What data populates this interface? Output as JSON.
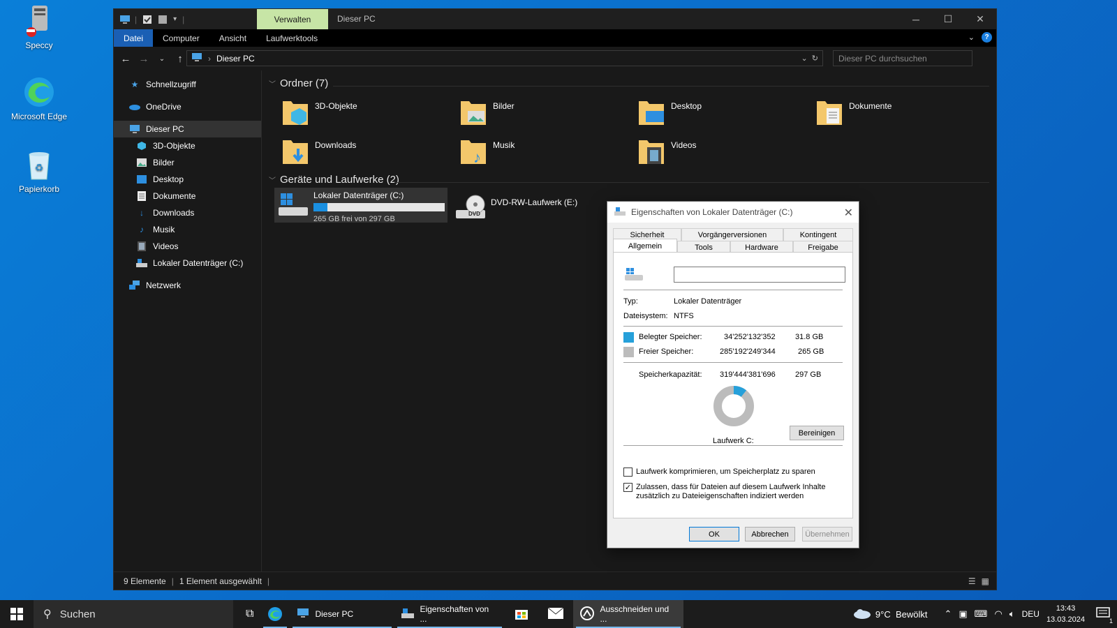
{
  "desktop": {
    "icons": [
      {
        "label": "Speccy"
      },
      {
        "label": "Microsoft Edge"
      },
      {
        "label": "Papierkorb"
      }
    ]
  },
  "explorer": {
    "context_tab": "Verwalten",
    "title": "Dieser PC",
    "ribbon_tabs": [
      "Datei",
      "Computer",
      "Ansicht",
      "Laufwerktools"
    ],
    "address_path": "Dieser PC",
    "search_placeholder": "Dieser PC durchsuchen",
    "sidebar": [
      {
        "label": "Schnellzugriff",
        "icon": "star-icon"
      },
      {
        "label": "OneDrive",
        "icon": "cloud-icon"
      },
      {
        "label": "Dieser PC",
        "icon": "pc-icon",
        "selected": true
      },
      {
        "label": "3D-Objekte",
        "icon": "cube-icon"
      },
      {
        "label": "Bilder",
        "icon": "pictures-icon"
      },
      {
        "label": "Desktop",
        "icon": "desktop-icon"
      },
      {
        "label": "Dokumente",
        "icon": "document-icon"
      },
      {
        "label": "Downloads",
        "icon": "download-icon"
      },
      {
        "label": "Musik",
        "icon": "music-icon"
      },
      {
        "label": "Videos",
        "icon": "video-icon"
      },
      {
        "label": "Lokaler Datenträger (C:)",
        "icon": "drive-icon"
      },
      {
        "label": "Netzwerk",
        "icon": "network-icon"
      }
    ],
    "folders_header": "Ordner (7)",
    "folders": [
      "3D-Objekte",
      "Bilder",
      "Desktop",
      "Dokumente",
      "Downloads",
      "Musik",
      "Videos"
    ],
    "devices_header": "Geräte und Laufwerke (2)",
    "drive_c": {
      "name": "Lokaler Datenträger (C:)",
      "free_text": "265 GB frei von 297 GB",
      "used_fraction": 0.107
    },
    "drive_e": {
      "name": "DVD-RW-Laufwerk (E:)"
    },
    "status": {
      "count": "9 Elemente",
      "selected": "1 Element ausgewählt"
    }
  },
  "dialog": {
    "title": "Eigenschaften von Lokaler Datenträger (C:)",
    "tabs_top": [
      "Sicherheit",
      "Vorgängerversionen",
      "Kontingent"
    ],
    "tabs_bottom": [
      "Allgemein",
      "Tools",
      "Hardware",
      "Freigabe"
    ],
    "name_value": "",
    "type_label": "Typ:",
    "type_value": "Lokaler Datenträger",
    "fs_label": "Dateisystem:",
    "fs_value": "NTFS",
    "used_label": "Belegter Speicher:",
    "used_bytes": "34'252'132'352",
    "used_gb": "31.8 GB",
    "free_label": "Freier Speicher:",
    "free_bytes": "285'192'249'344",
    "free_gb": "265 GB",
    "cap_label": "Speicherkapazität:",
    "cap_bytes": "319'444'381'696",
    "cap_gb": "297 GB",
    "drive_label": "Laufwerk C:",
    "cleanup_button": "Bereinigen",
    "used_fraction": 0.107,
    "compress_label": "Laufwerk komprimieren, um Speicherplatz zu sparen",
    "compress_checked": false,
    "index_label_1": "Zulassen, dass für Dateien auf diesem Laufwerk Inhalte",
    "index_label_2": "zusätzlich zu Dateieigenschaften indiziert werden",
    "index_checked": true,
    "ok": "OK",
    "cancel": "Abbrechen",
    "apply": "Übernehmen",
    "colors": {
      "used": "#26a0da",
      "free": "#bcbcbc"
    }
  },
  "taskbar": {
    "search": "Suchen",
    "apps": [
      {
        "label": "Dieser PC"
      },
      {
        "label": "Eigenschaften von ..."
      },
      {
        "label": "Ausschneiden und ..."
      }
    ],
    "weather": "9°C  Bewölkt",
    "lang": "DEU",
    "time": "13:43",
    "date": "13.03.2024",
    "notifications": "1"
  }
}
